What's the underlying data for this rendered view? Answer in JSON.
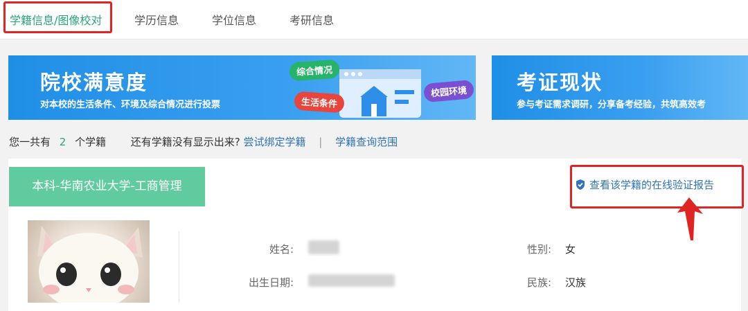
{
  "tabs": [
    {
      "label": "学籍信息/图像校对",
      "active": true
    },
    {
      "label": "学历信息",
      "active": false
    },
    {
      "label": "学位信息",
      "active": false
    },
    {
      "label": "考研信息",
      "active": false
    }
  ],
  "banners": [
    {
      "title": "院校满意度",
      "subtitle": "对本校的生活条件、环境及综合情况进行投票",
      "tags": [
        "综合情况",
        "生活条件",
        "校园环境"
      ]
    },
    {
      "title": "考证现状",
      "subtitle": "参与考证需求调研，分享备考经验，共筑高效考"
    }
  ],
  "summary": {
    "prefix": "您一共有",
    "count": "2",
    "suffix": "个学籍",
    "hint": "还有学籍没有显示出来?",
    "bind_link": "尝试绑定学籍",
    "separator": "|",
    "range_link": "学籍查询范围"
  },
  "record": {
    "tab_label": "本科-华南农业大学-工商管理",
    "verify_link": "查看该学籍的在线验证报告",
    "fields": {
      "name_label": "姓名:",
      "gender_label": "性别:",
      "gender_value": "女",
      "birth_label": "出生日期:",
      "ethnicity_label": "民族:",
      "ethnicity_value": "汉族"
    }
  },
  "colors": {
    "accent_green": "#2aa57a",
    "tab_green": "#5fcb9f",
    "link_blue": "#2f73b8",
    "annotation_red": "#e02424"
  },
  "icons": {
    "verify": "shield-check-icon",
    "annotation": "red-arrow-icon"
  }
}
